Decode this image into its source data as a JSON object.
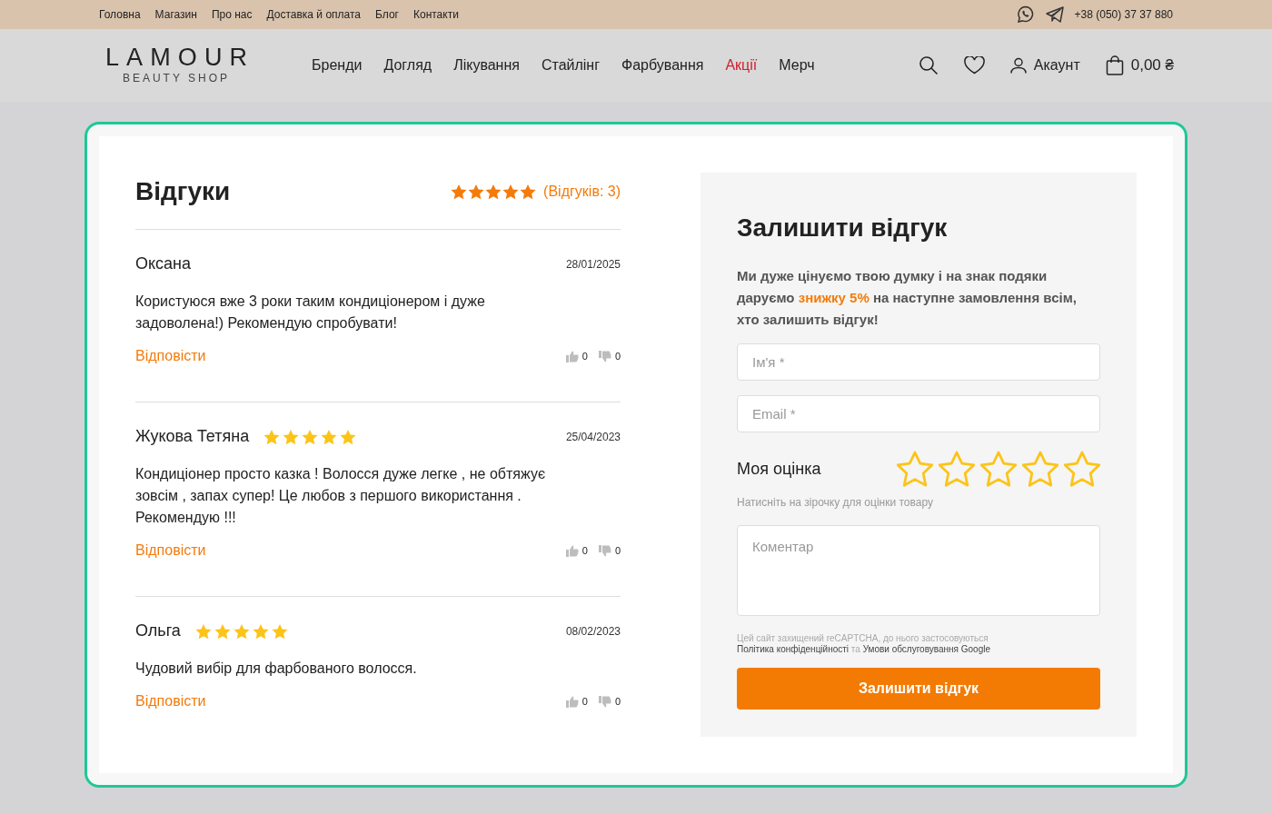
{
  "top_bar": {
    "links": [
      "Головна",
      "Магазин",
      "Про нас",
      "Доставка й оплата",
      "Блог",
      "Контакти"
    ],
    "phone": "+38 (050) 37 37 880"
  },
  "header": {
    "logo": {
      "title": "LAMOUR",
      "subtitle": "BEAUTY SHOP"
    },
    "nav": [
      {
        "label": "Бренди",
        "kind": "normal"
      },
      {
        "label": "Догляд",
        "kind": "normal"
      },
      {
        "label": "Лікування",
        "kind": "normal"
      },
      {
        "label": "Стайлінг",
        "kind": "normal"
      },
      {
        "label": "Фарбування",
        "kind": "normal"
      },
      {
        "label": "Акції",
        "kind": "sale"
      },
      {
        "label": "Мерч",
        "kind": "normal"
      }
    ],
    "account": "Акаунт",
    "cart_total": "0,00 ₴"
  },
  "reviews": {
    "title": "Відгуки",
    "stars": 5,
    "count": "(Відгуків: 3)",
    "items": [
      {
        "author": "Оксана",
        "date": "28/01/2025",
        "text": "Користуюся вже 3 роки таким кондиціонером і дуже задоволена!) Рекомендую спробувати!",
        "reply": "Відповісти",
        "likes": "0",
        "dislikes": "0"
      },
      {
        "author": "Жукова Тетяна",
        "stars": 5,
        "date": "25/04/2023",
        "text": "Кондиціонер просто казка ! Волосся дуже легке , не обтяжує зовсім , запах супер! Це любов з першого використання . Рекомендую !!!",
        "reply": "Відповісти",
        "likes": "0",
        "dislikes": "0"
      },
      {
        "author": "Ольга",
        "stars": 5,
        "date": "08/02/2023",
        "text": "Чудовий вибір для фарбованого волосся.",
        "reply": "Відповісти",
        "likes": "0",
        "dislikes": "0"
      }
    ]
  },
  "form": {
    "title": "Залишити відгук",
    "intro": {
      "before": "Ми дуже цінуємо твою думку і на знак подяки даруємо ",
      "highlight": "знижку 5%",
      "after": " на наступне замовлення всім, хто залишить відгук!"
    },
    "name_placeholder": "Ім'я *",
    "email_placeholder": "Email *",
    "rating_label": "Моя оцінка",
    "stars": 0,
    "rating_hint": "Натисніть на зірочку для оцінки товару",
    "comment_placeholder": "Коментар",
    "consent": [
      {
        "kind": "text",
        "text": "Цей сайт захищений reCAPTCHA, до нього застосовуються "
      },
      {
        "kind": "link",
        "text": "Політика конфіденційності"
      },
      {
        "kind": "text",
        "text": " та "
      },
      {
        "kind": "link",
        "text": "Умови обслуговування Google"
      }
    ],
    "submit": "Залишити відгук"
  }
}
